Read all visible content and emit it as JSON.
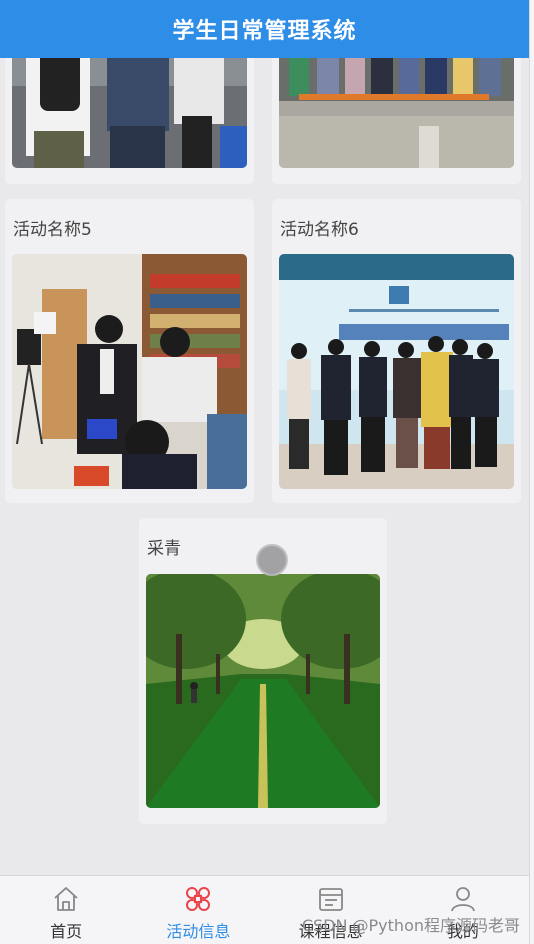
{
  "header": {
    "title": "学生日常管理系统"
  },
  "activities": [
    {
      "name": "活动名称5"
    },
    {
      "name": "活动名称6"
    },
    {
      "name": "采青"
    }
  ],
  "tabbar": {
    "items": [
      {
        "label": "首页",
        "icon": "home-icon",
        "active": false
      },
      {
        "label": "活动信息",
        "icon": "activity-icon",
        "active": true
      },
      {
        "label": "课程信息",
        "icon": "course-icon",
        "active": false
      },
      {
        "label": "我的",
        "icon": "user-icon",
        "active": false
      }
    ]
  },
  "watermark": "CSDN @Python程序源码老哥",
  "colors": {
    "primary": "#2e8de6",
    "active_icon": "#e8444a"
  }
}
